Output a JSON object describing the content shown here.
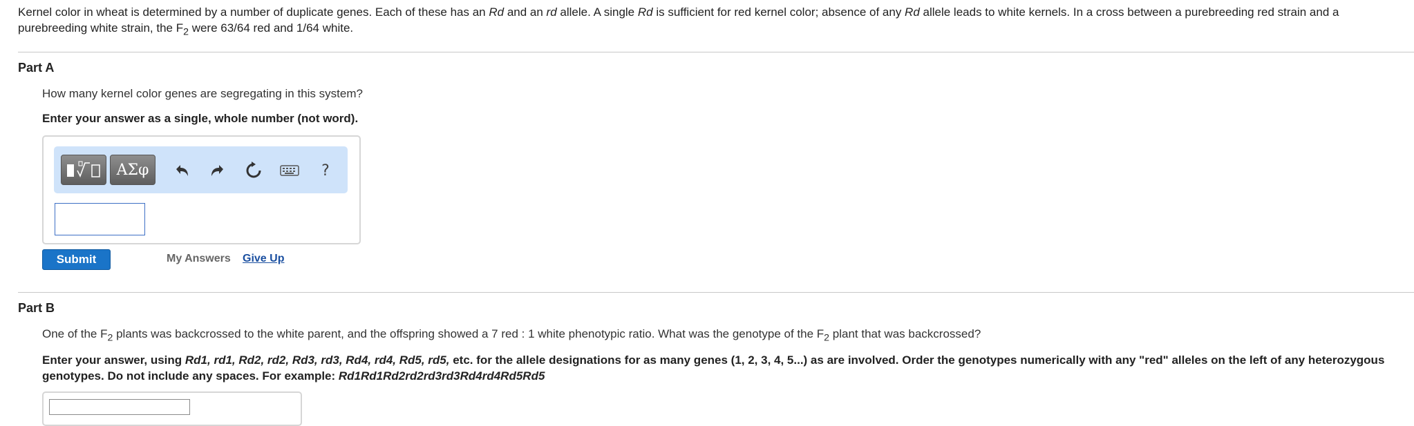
{
  "intro": {
    "t1": "Kernel color in wheat is determined by a number of duplicate genes. Each of these has an ",
    "rd_upper": "Rd",
    "t2": " and an ",
    "rd_lower": "rd",
    "t3": " allele. A single ",
    "t4": " is sufficient for red kernel color; absence of any ",
    "t5": " allele leads to white kernels. In a cross between a purebreeding red strain and a purebreeding white strain, the F",
    "sub2": "2",
    "t6": " were 63/64 red and 1/64 white."
  },
  "partA": {
    "title": "Part A",
    "question": "How many kernel color genes are segregating in this system?",
    "instruction": "Enter your answer as a single, whole number (not word).",
    "toolbar": {
      "greek_label": "ΑΣφ",
      "help_label": "?"
    },
    "answer_value": "",
    "submit_label": "Submit",
    "my_answers_label": "My Answers",
    "give_up_label": "Give Up"
  },
  "partB": {
    "title": "Part B",
    "q1": "One of the F",
    "q_sub": "2",
    "q2": " plants was backcrossed to the white parent, and the offspring showed a 7 red : 1 white phenotypic ratio. What was the genotype of the F",
    "q3": " plant that was backcrossed?",
    "i1": "Enter your answer, using ",
    "i_alleles": "Rd1, rd1, Rd2, rd2, Rd3, rd3, Rd4, rd4, Rd5, rd5,",
    "i2": " etc. for the allele designations for as many genes (1, 2, 3, 4, 5...) as are involved.  Order the genotypes numerically with any \"red\" alleles on the left of any heterozygous genotypes.  Do not include any spaces.  For example:  ",
    "i_example": "Rd1Rd1Rd2rd2rd3rd3Rd4rd4Rd5Rd5",
    "answer_value": ""
  }
}
